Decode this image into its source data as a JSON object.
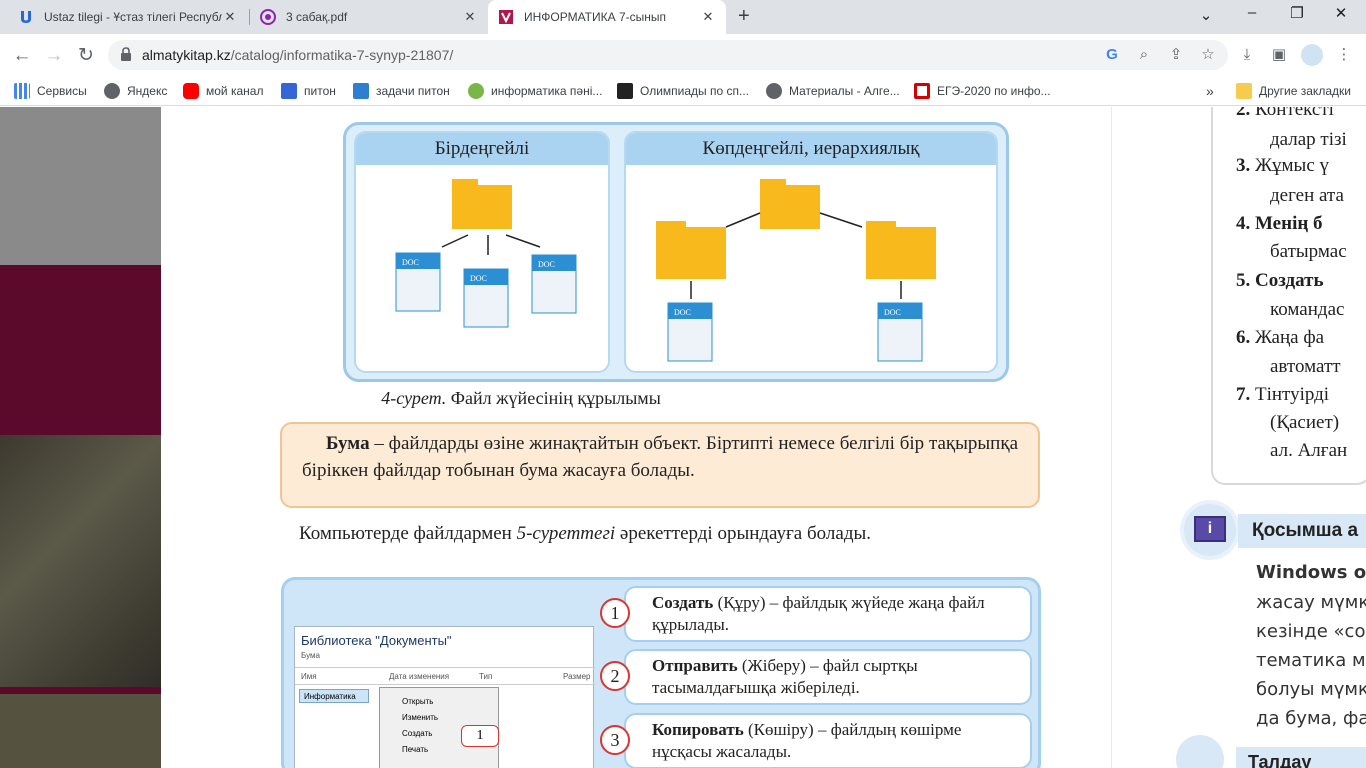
{
  "browser": {
    "tabs": [
      {
        "title": "Ustaz tilegi - Ұстаз тілегі Республ",
        "close": "✕"
      },
      {
        "title": "3 сабақ.pdf",
        "close": "✕"
      },
      {
        "title": "ИНФОРМАТИКА 7-сынып",
        "close": "✕"
      }
    ],
    "new_tab": "+",
    "window": {
      "minimize": "⌄",
      "min": "–",
      "max": "❐",
      "close": "✕"
    },
    "url_domain": "almatykitap.kz",
    "url_path": "/catalog/informatika-7-synyp-21807/",
    "bookmarks": [
      {
        "label": "Сервисы",
        "color": "#4285f4"
      },
      {
        "label": "Яндекс",
        "color": "#5f6368"
      },
      {
        "label": "мой канал",
        "color": "#ff0000"
      },
      {
        "label": "питон",
        "color": "#3367d6"
      },
      {
        "label": "задачи питон",
        "color": "#2f7fd1"
      },
      {
        "label": "информатика пәні...",
        "color": "#7ab648"
      },
      {
        "label": "Олимпиады по сп...",
        "color": "#222222"
      },
      {
        "label": "Материалы - Алге...",
        "color": "#5f6368"
      },
      {
        "label": "ЕГЭ-2020 по инфо...",
        "color": "#d50000"
      }
    ],
    "more_bookmarks": "»",
    "other_bookmarks": "Другие закладки"
  },
  "book": {
    "panel_left_title": "Бірдеңгейлі",
    "panel_right_title": "Көпдеңгейлі, иерархиялық",
    "doc_label": "DOC",
    "figure_caption_italic": "4-сурет.",
    "figure_caption_rest": " Файл жүйесінің құрылымы",
    "definition_bold": "Бума",
    "definition_text": " – файлдарды өзіне жинақтайтын объект. Біртипті немесе белгілі бір тақырыпқа біріккен файлдар тобынан бума жасауға болады.",
    "para_start": "Компьютерде файлдармен ",
    "para_italic": "5-суреттегі",
    "para_end": " әрекеттерді орындауға болады.",
    "screenshot": {
      "title": "Библиотека \"Документы\"",
      "subtitle": "Бума",
      "col_name": "Имя",
      "col_date": "Дата изменения",
      "col_type": "Тип",
      "col_size": "Размер",
      "folder": "Информатика",
      "menu": [
        "Открыть",
        "Изменить",
        "Создать",
        "Печать"
      ],
      "callout": "1"
    },
    "steps": [
      {
        "num": "1",
        "bold": "Создать",
        "text": " (Құру) – файлдық жүйеде жаңа файл құрылады."
      },
      {
        "num": "2",
        "bold": "Отправить",
        "text": " (Жіберу) – файл сыртқы тасымалдағышқа жіберіледі."
      },
      {
        "num": "3",
        "bold": "Копировать",
        "text": " (Көшіру) – файлдың көшірме нұсқасы жасалады."
      }
    ]
  },
  "right_page": {
    "lines": [
      {
        "num": "2.",
        "text": "Контексті"
      },
      {
        "num": "",
        "text": "далар тізі"
      },
      {
        "num": "3.",
        "text": "Жұмыс ү"
      },
      {
        "num": "",
        "text": "деген ата"
      },
      {
        "num": "4.",
        "text": "Менің б"
      },
      {
        "num": "",
        "text": "батырмас"
      },
      {
        "num": "5.",
        "text": "Создать"
      },
      {
        "num": "",
        "text": "командас"
      },
      {
        "num": "6.",
        "text": "Жаңа фа"
      },
      {
        "num": "",
        "text": "автоматт"
      },
      {
        "num": "7.",
        "text": "Тінтуірді"
      },
      {
        "num": "",
        "text": "(Қасиет)"
      },
      {
        "num": "",
        "text": "ал. Алған"
      }
    ],
    "info_title": "Қосымша а",
    "info_lines": [
      "Windows о",
      "жасау мүмк",
      "кезінде «со",
      "тематика м",
      "болуы мүмк",
      "да бума, фа"
    ],
    "analysis_title": "Талдау"
  }
}
